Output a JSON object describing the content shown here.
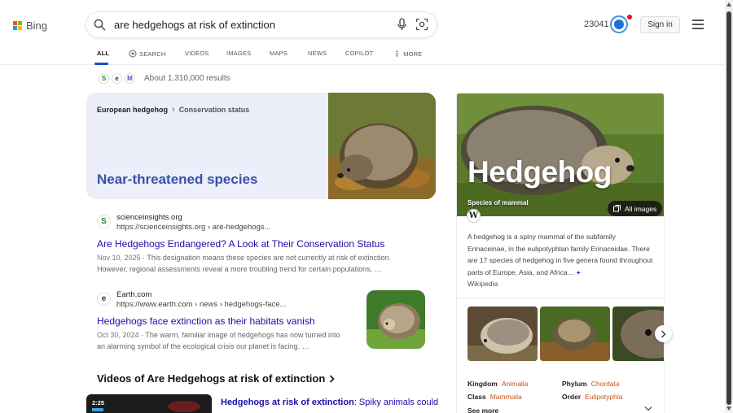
{
  "header": {
    "logo_text": "Bing",
    "search_query": "are hedgehogs at risk of extinction",
    "points": "23041",
    "sign_in_label": "Sign in",
    "icons": [
      "search-icon",
      "mic-icon",
      "visual-search-icon",
      "rewards-icon",
      "hamburger-menu-icon"
    ],
    "brand_colors": {
      "ms_red": "#f25022",
      "ms_green": "#7fba00",
      "ms_blue": "#00a4ef",
      "ms_yellow": "#ffb900",
      "accent": "#174ae4"
    }
  },
  "tabs": [
    {
      "label": "ALL",
      "active": true
    },
    {
      "label": "SEARCH",
      "active": false
    },
    {
      "label": "VIDEOS",
      "active": false
    },
    {
      "label": "IMAGES",
      "active": false
    },
    {
      "label": "MAPS",
      "active": false
    },
    {
      "label": "NEWS",
      "active": false
    },
    {
      "label": "COPILOT",
      "active": false
    },
    {
      "label": "MORE",
      "active": false
    }
  ],
  "results_meta": {
    "count_text": "About 1,310,000 results"
  },
  "answer_card": {
    "subject": "European hedgehog",
    "attribute": "Conservation status",
    "value": "Near-threatened species"
  },
  "results": [
    {
      "site_name": "scienceinsights.org",
      "site_url": "https://scienceinsights.org › are-hedgehogs...",
      "favicon_letter": "S",
      "title": "Are Hedgehogs Endangered? A Look at Their Conservation Status",
      "date": "Nov 10, 2025",
      "snippet": " · This designation means these species are not currently at risk of extinction. However, regional assessments reveal a more troubling trend for certain populations, …"
    },
    {
      "site_name": "Earth.com",
      "site_url": "https://www.earth.com › news › hedgehogs-face...",
      "favicon_letter": "e",
      "title": "Hedgehogs face extinction as their habitats vanish",
      "date": "Oct 30, 2024",
      "snippet": " · The warm, familiar image of hedgehogs has now turned into an alarming symbol of the ecological crisis our planet is facing. …"
    }
  ],
  "videos": {
    "heading": "Videos of Are Hedgehogs at risk of extinction",
    "first_duration": "2:25",
    "first_title_bold": "Hedgehogs at risk of extinction",
    "first_title_rest": ": Spiky animals could"
  },
  "knowledge_panel": {
    "title": "Hedgehog",
    "subtitle": "Species of mammal",
    "all_images_label": "All images",
    "wiki_letter": "W",
    "description": "A hedgehog is a spiny mammal of the subfamily Erinaceinae, in the eulipotyphlan family Erinaceidae. There are 17 species of hedgehog in five genera found throughout parts of Europe, Asia, and Africa…",
    "more_symbol": "+",
    "source": "Wikipedia",
    "facts": [
      {
        "key": "Kingdom",
        "value": "Animalia"
      },
      {
        "key": "Phylum",
        "value": "Chordata"
      },
      {
        "key": "Class",
        "value": "Mammalia"
      },
      {
        "key": "Order",
        "value": "Eulipotyphla"
      }
    ],
    "see_more_label": "See more"
  }
}
